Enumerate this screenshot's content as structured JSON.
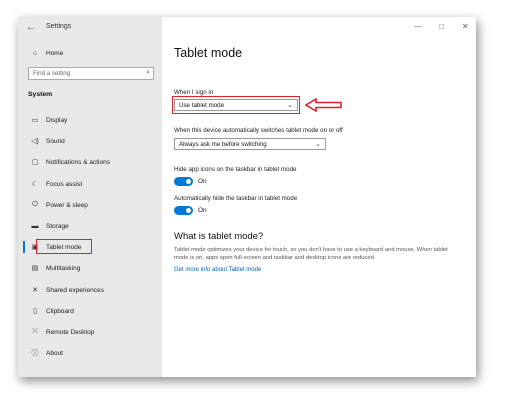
{
  "window": {
    "app_title": "Settings",
    "back_icon": "arrow-left-icon",
    "controls": {
      "minimize": "—",
      "maximize": "□",
      "close": "✕"
    }
  },
  "sidebar": {
    "home": {
      "label": "Home",
      "icon": "home-icon"
    },
    "search": {
      "placeholder": "Find a setting",
      "icon": "search-icon"
    },
    "section": "System",
    "items": [
      {
        "label": "Display",
        "icon": "display-icon"
      },
      {
        "label": "Sound",
        "icon": "sound-icon"
      },
      {
        "label": "Notifications & actions",
        "icon": "notifications-icon"
      },
      {
        "label": "Focus assist",
        "icon": "moon-icon"
      },
      {
        "label": "Power & sleep",
        "icon": "power-icon"
      },
      {
        "label": "Storage",
        "icon": "storage-icon"
      },
      {
        "label": "Tablet mode",
        "icon": "tablet-icon",
        "active": true
      },
      {
        "label": "Multitasking",
        "icon": "multitasking-icon"
      },
      {
        "label": "Shared experiences",
        "icon": "shared-icon"
      },
      {
        "label": "Clipboard",
        "icon": "clipboard-icon"
      },
      {
        "label": "Remote Desktop",
        "icon": "remote-desktop-icon"
      },
      {
        "label": "About",
        "icon": "info-icon"
      }
    ]
  },
  "main": {
    "title": "Tablet mode",
    "signin_label": "When I sign in",
    "signin_value": "Use tablet mode",
    "switch_label": "When this device automatically switches tablet mode on or off",
    "switch_value": "Always ask me before switching",
    "hide_icons_label": "Hide app icons on the taskbar in tablet mode",
    "hide_icons_state": "On",
    "hide_taskbar_label": "Automatically hide the taskbar in tablet mode",
    "hide_taskbar_state": "On",
    "what_title": "What is tablet mode?",
    "description": "Tablet mode optimizes your device for touch, so you don't have to use a keyboard and mouse. When tablet mode is on, apps open full-screen and taskbar and desktop icons are reduced.",
    "link": "Get more info about Tablet mode"
  },
  "annotation": {
    "color": "#e0202a"
  },
  "colors": {
    "accent": "#0078d7",
    "link": "#0067b8",
    "sidebar_bg": "#e8e8e8"
  }
}
